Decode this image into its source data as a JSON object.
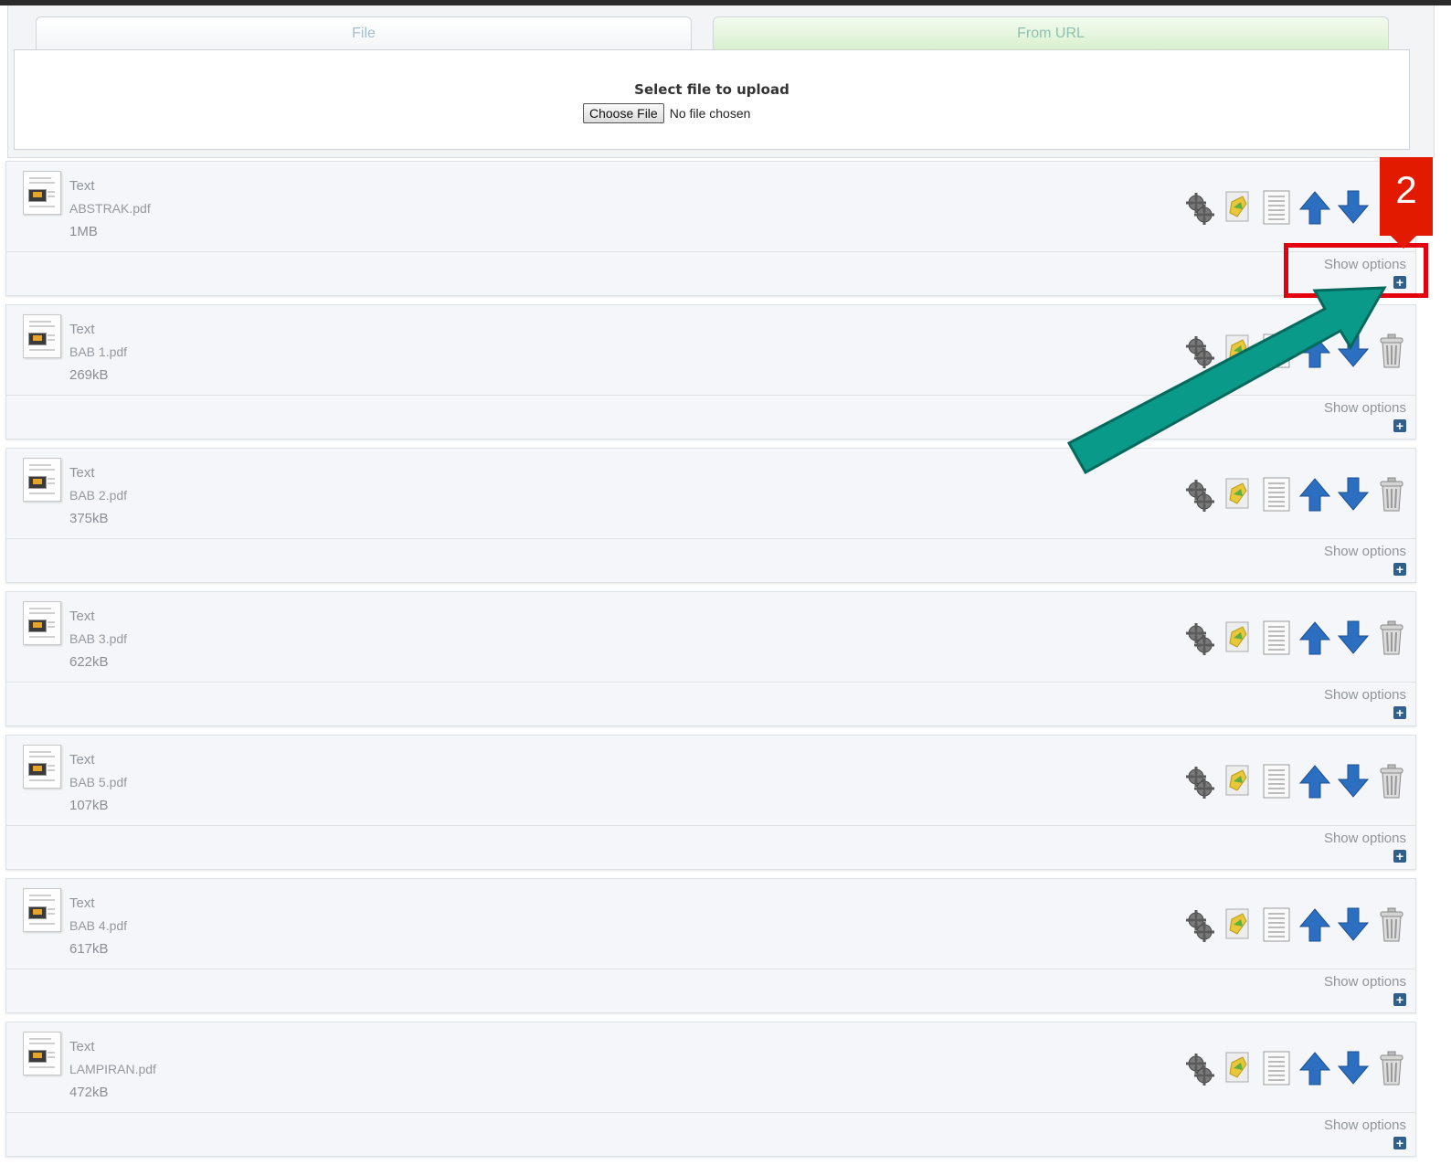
{
  "tabs": {
    "file": "File",
    "url": "From URL"
  },
  "upload": {
    "title": "Select file to upload",
    "button": "Choose File",
    "status": "No file chosen"
  },
  "files": [
    {
      "type": "Text",
      "name": "ABSTRAK.pdf",
      "size": "1MB"
    },
    {
      "type": "Text",
      "name": "BAB 1.pdf",
      "size": "269kB"
    },
    {
      "type": "Text",
      "name": "BAB 2.pdf",
      "size": "375kB"
    },
    {
      "type": "Text",
      "name": "BAB 3.pdf",
      "size": "622kB"
    },
    {
      "type": "Text",
      "name": "BAB 5.pdf",
      "size": "107kB"
    },
    {
      "type": "Text",
      "name": "BAB 4.pdf",
      "size": "617kB"
    },
    {
      "type": "Text",
      "name": "LAMPIRAN.pdf",
      "size": "472kB"
    }
  ],
  "item_actions": [
    "gear-icon",
    "edit-document-icon",
    "list-icon",
    "arrow-up-icon",
    "arrow-down-icon",
    "trash-icon"
  ],
  "show_options_label": "Show options",
  "show_options_toggle": "+",
  "annotation": {
    "step": "2",
    "highlight_color": "#e3000f",
    "arrow_color": "#0a9a8a"
  }
}
